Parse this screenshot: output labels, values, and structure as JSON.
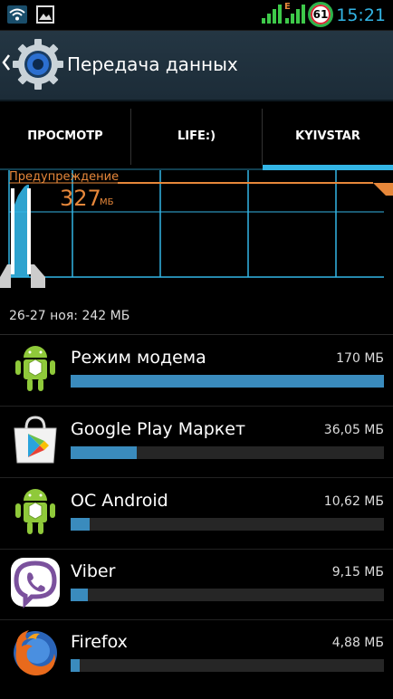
{
  "status_bar": {
    "time": "15:21",
    "battery_level": "61",
    "network_badge": "E",
    "icons": [
      "wifi-icon",
      "image-notification-icon",
      "signal-icon",
      "signal-icon",
      "battery-icon"
    ]
  },
  "action_bar": {
    "title": "Передача данных",
    "icon": "settings-gear-icon"
  },
  "tabs": [
    {
      "label": "ПРОСМОТР",
      "selected": false
    },
    {
      "label": "LIFE:)",
      "selected": false
    },
    {
      "label": "KYIVSTAR",
      "selected": true
    }
  ],
  "chart": {
    "warning_label": "Предупреждение",
    "warning_value": "327",
    "warning_unit": "МБ",
    "colors": {
      "warning": "#e6873a",
      "grid": "#33b5e5",
      "usage": "#33b5e5"
    }
  },
  "range": {
    "text": "26-27 ноя: 242 МБ"
  },
  "apps": [
    {
      "name": "Режим модема",
      "size": "170 МБ",
      "usage_fraction": 1.0,
      "icon": "android-icon"
    },
    {
      "name": "Google Play Маркет",
      "size": "36,05 МБ",
      "usage_fraction": 0.21,
      "icon": "google-play-icon"
    },
    {
      "name": "ОС Android",
      "size": "10,62 МБ",
      "usage_fraction": 0.062,
      "icon": "android-icon"
    },
    {
      "name": "Viber",
      "size": "9,15 МБ",
      "usage_fraction": 0.054,
      "icon": "viber-icon"
    },
    {
      "name": "Firefox",
      "size": "4,88 МБ",
      "usage_fraction": 0.029,
      "icon": "firefox-icon"
    }
  ]
}
